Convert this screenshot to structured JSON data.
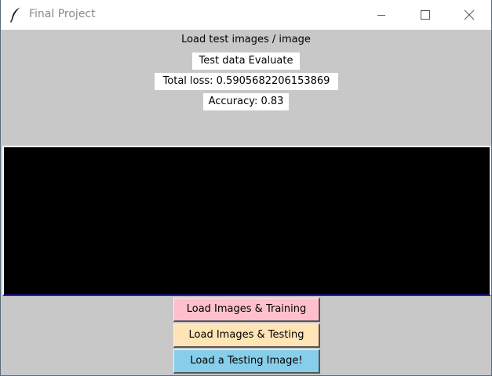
{
  "window": {
    "title": "Final Project",
    "icon": "feather-icon",
    "controls": [
      "minimize-icon",
      "maximize-icon",
      "close-icon"
    ]
  },
  "labels": {
    "heading": "Load test images / image",
    "evaluate": "Test data Evaluate",
    "loss": "Total loss: 0.5905682206153869",
    "accuracy": "Accuracy: 0.83"
  },
  "buttons": {
    "train": "Load Images & Training",
    "test": "Load Images & Testing",
    "single": "Load a Testing Image!"
  },
  "colors": {
    "background": "#c8c8c8",
    "canvas": "#000000",
    "train_button": "#ffc0cb",
    "test_button": "#ffe4b5",
    "single_button": "#87ceeb"
  }
}
